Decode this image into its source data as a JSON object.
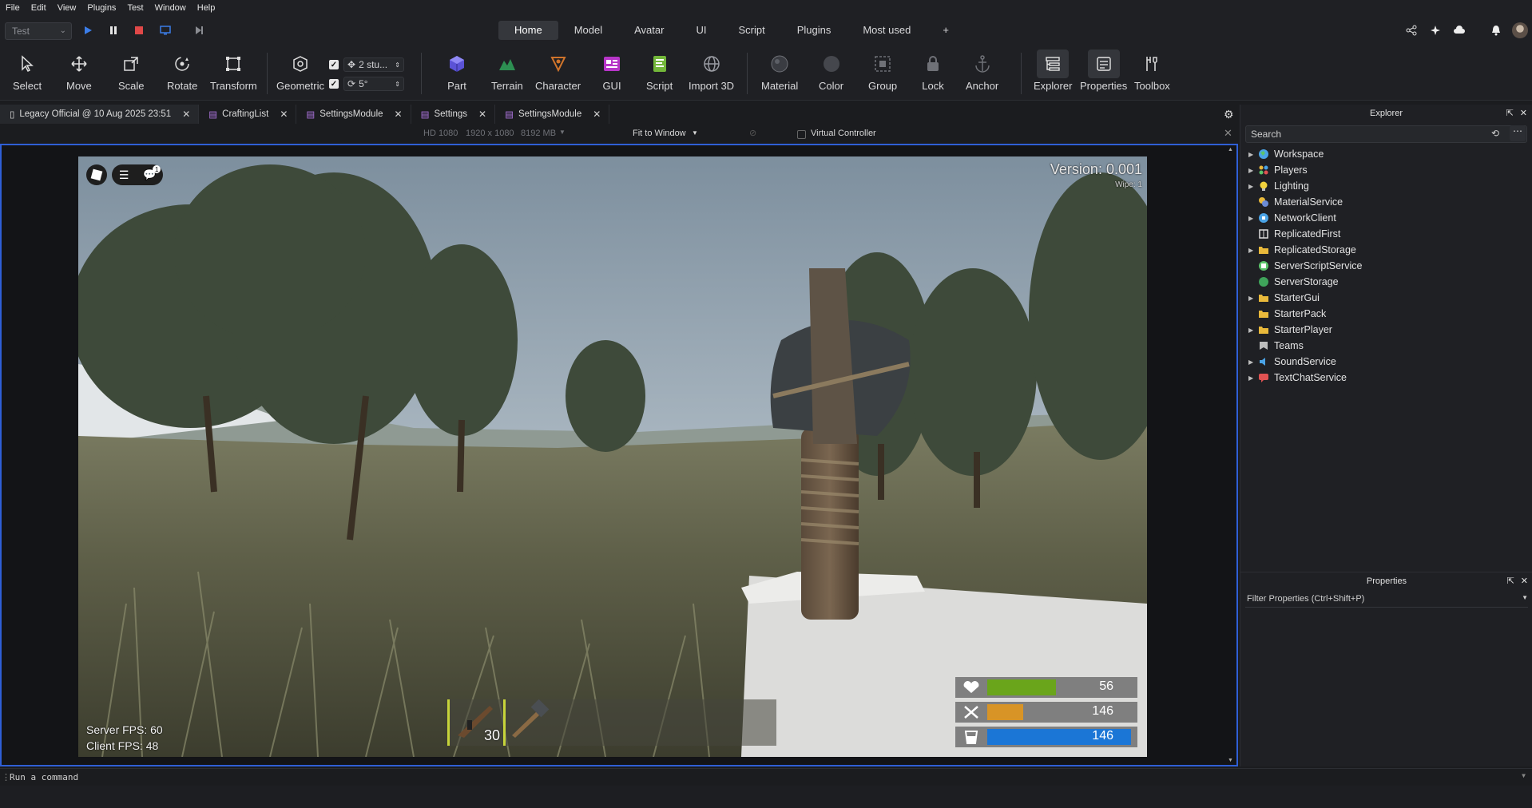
{
  "menu": [
    "File",
    "Edit",
    "View",
    "Plugins",
    "Test",
    "Window",
    "Help"
  ],
  "test_select": {
    "value": "Test"
  },
  "ribbon_tabs": [
    "Home",
    "Model",
    "Avatar",
    "UI",
    "Script",
    "Plugins",
    "Most used",
    "+"
  ],
  "active_ribbon_tab": "Home",
  "tools": {
    "select": "Select",
    "move": "Move",
    "scale": "Scale",
    "rotate": "Rotate",
    "transform": "Transform",
    "geometric": "Geometric",
    "snap_move": "2 stu...",
    "snap_rotate": "5°",
    "part": "Part",
    "terrain": "Terrain",
    "character": "Character",
    "gui": "GUI",
    "script": "Script",
    "import3d": "Import 3D",
    "material": "Material",
    "color": "Color",
    "group": "Group",
    "lock": "Lock",
    "anchor": "Anchor",
    "explorer": "Explorer",
    "properties": "Properties",
    "toolbox": "Toolbox"
  },
  "doc_tabs": [
    {
      "label": "Legacy Official @ 10 Aug 2025 23:51"
    },
    {
      "label": "CraftingList"
    },
    {
      "label": "SettingsModule"
    },
    {
      "label": "Settings"
    },
    {
      "label": "SettingsModule"
    }
  ],
  "viewport_bar": {
    "device": "HD 1080",
    "resolution": "1920 x 1080",
    "memory": "8192 MB",
    "fit": "Fit to Window",
    "virtual_controller": "Virtual Controller"
  },
  "game": {
    "version": "Version: 0.001",
    "wipe": "Wipe: 1",
    "notif_count": "1",
    "server_fps": "Server FPS: 60",
    "client_fps": "Client FPS: 48",
    "ammo": "30",
    "health": 56,
    "hunger": 146,
    "thirst": 146,
    "health_color": "#6aa51b",
    "hunger_color": "#d89426",
    "thirst_color": "#1b76d6"
  },
  "command_placeholder": "Run a command",
  "explorer": {
    "title": "Explorer",
    "search_placeholder": "Search",
    "items": [
      {
        "label": "Workspace",
        "expandable": true,
        "icon": "globe-icon"
      },
      {
        "label": "Players",
        "expandable": true,
        "icon": "players-icon"
      },
      {
        "label": "Lighting",
        "expandable": true,
        "icon": "lightbulb-icon"
      },
      {
        "label": "MaterialService",
        "expandable": false,
        "icon": "material-icon"
      },
      {
        "label": "NetworkClient",
        "expandable": true,
        "icon": "network-icon"
      },
      {
        "label": "ReplicatedFirst",
        "expandable": false,
        "icon": "replicated-first-icon"
      },
      {
        "label": "ReplicatedStorage",
        "expandable": true,
        "icon": "folder-icon"
      },
      {
        "label": "ServerScriptService",
        "expandable": false,
        "icon": "server-script-icon"
      },
      {
        "label": "ServerStorage",
        "expandable": false,
        "icon": "server-storage-icon"
      },
      {
        "label": "StarterGui",
        "expandable": true,
        "icon": "folder-icon"
      },
      {
        "label": "StarterPack",
        "expandable": false,
        "icon": "folder-icon"
      },
      {
        "label": "StarterPlayer",
        "expandable": true,
        "icon": "folder-icon"
      },
      {
        "label": "Teams",
        "expandable": false,
        "icon": "teams-icon"
      },
      {
        "label": "SoundService",
        "expandable": true,
        "icon": "sound-icon"
      },
      {
        "label": "TextChatService",
        "expandable": true,
        "icon": "chat-icon"
      }
    ]
  },
  "properties": {
    "title": "Properties",
    "filter_placeholder": "Filter Properties (Ctrl+Shift+P)"
  }
}
